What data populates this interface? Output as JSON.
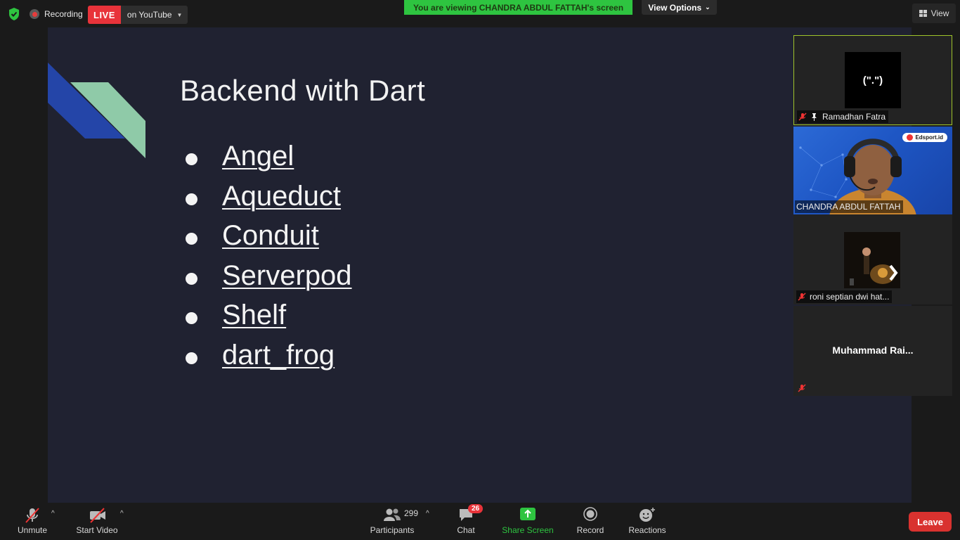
{
  "topbar": {
    "recording_label": "Recording",
    "live_label": "LIVE",
    "stream_target": "on YouTube",
    "viewing_banner": "You are viewing CHANDRA ABDUL FATTAH's screen",
    "view_options_label": "View Options",
    "view_label": "View"
  },
  "slide": {
    "title": "Backend with Dart",
    "bullets": [
      "Angel",
      "Aqueduct",
      "Conduit",
      "Serverpod",
      "Shelf",
      "dart_frog"
    ],
    "colors": {
      "background": "#202231",
      "shape_blue": "#2445a8",
      "shape_green": "#8fcaa8"
    }
  },
  "participants": [
    {
      "name": "Ramadhan Fatra",
      "avatar_text": "(\".\")",
      "muted": true,
      "pinned": true,
      "active_speaker": true
    },
    {
      "name": "CHANDRA ABDUL FATTAH",
      "video_on": true,
      "overlay_logo": "Edsport.id"
    },
    {
      "name": "roni septian dwi hat...",
      "muted": true
    },
    {
      "name": "Muhammad  Rai...",
      "muted": true
    }
  ],
  "toolbar": {
    "unmute_label": "Unmute",
    "start_video_label": "Start Video",
    "participants_label": "Participants",
    "participants_count": "299",
    "chat_label": "Chat",
    "chat_badge": "26",
    "share_screen_label": "Share Screen",
    "record_label": "Record",
    "reactions_label": "Reactions",
    "leave_label": "Leave"
  },
  "colors": {
    "accent_green": "#2ec440",
    "danger_red": "#e8333a",
    "active_border": "#9fc32a"
  }
}
